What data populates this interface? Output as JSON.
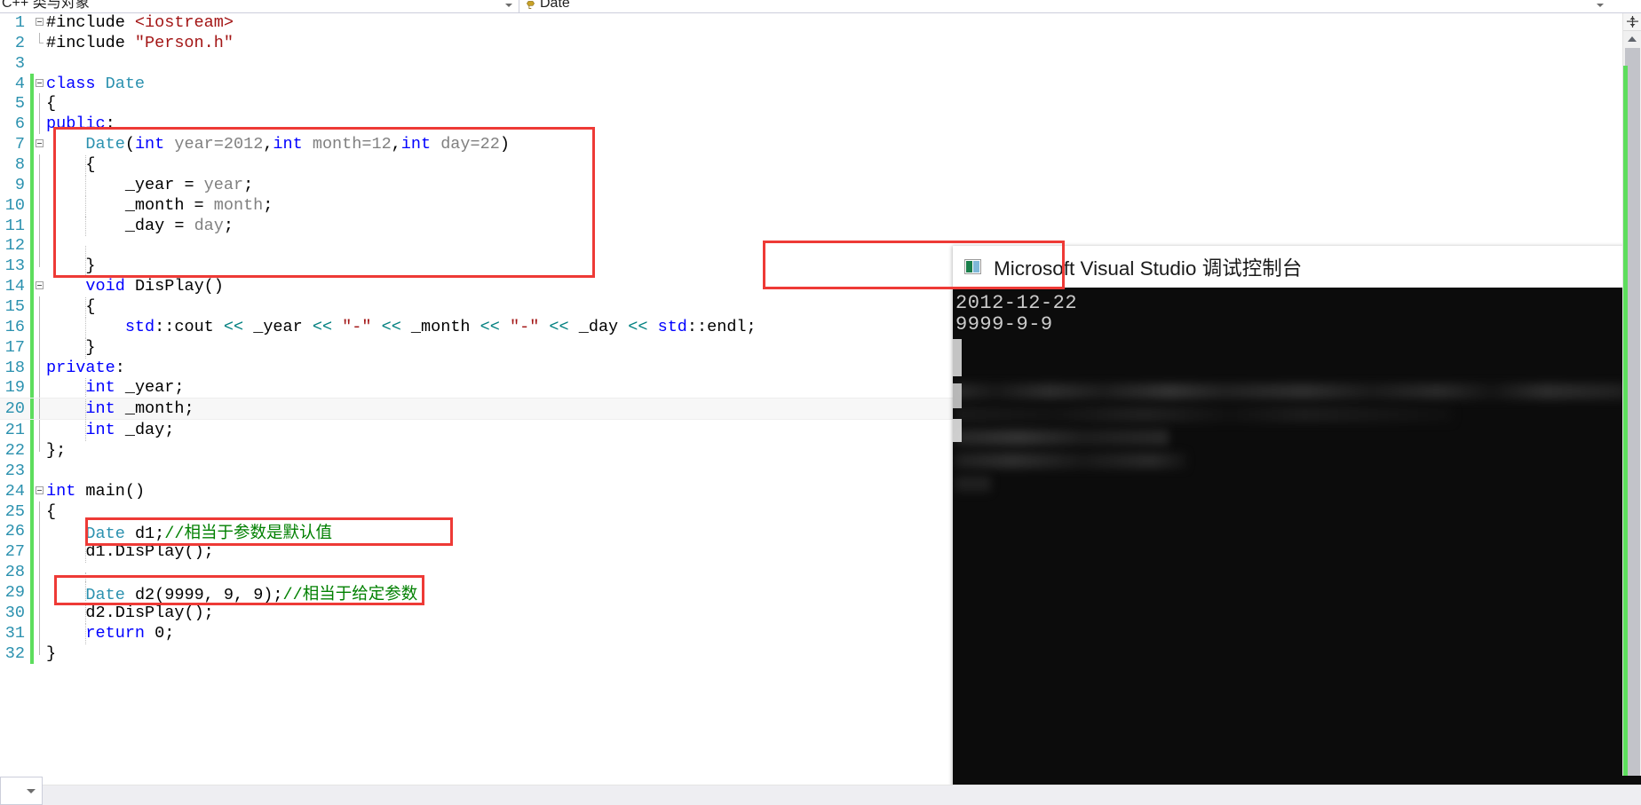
{
  "nav": {
    "left_combo": "C++ 类与对象",
    "right_combo": "Date",
    "left_caret_icon": "chevron-down-icon",
    "right_caret_icon": "chevron-down-icon",
    "class_icon": "class-icon"
  },
  "editor": {
    "lines": [
      {
        "n": "1",
        "text": "#include <iostream>"
      },
      {
        "n": "2",
        "text": "#include \"Person.h\""
      },
      {
        "n": "3",
        "text": ""
      },
      {
        "n": "4",
        "text": "class Date"
      },
      {
        "n": "5",
        "text": "{"
      },
      {
        "n": "6",
        "text": "public:"
      },
      {
        "n": "7",
        "text": "    Date(int year=2012,int month=12,int day=22)"
      },
      {
        "n": "8",
        "text": "    {"
      },
      {
        "n": "9",
        "text": "        _year = year;"
      },
      {
        "n": "10",
        "text": "        _month = month;"
      },
      {
        "n": "11",
        "text": "        _day = day;"
      },
      {
        "n": "12",
        "text": ""
      },
      {
        "n": "13",
        "text": "    }"
      },
      {
        "n": "14",
        "text": "    void DisPlay()"
      },
      {
        "n": "15",
        "text": "    {"
      },
      {
        "n": "16",
        "text": "        std::cout << _year << \"-\" << _month << \"-\" << _day << std::endl;"
      },
      {
        "n": "17",
        "text": "    }"
      },
      {
        "n": "18",
        "text": "private:"
      },
      {
        "n": "19",
        "text": "    int _year;"
      },
      {
        "n": "20",
        "text": "    int _month;"
      },
      {
        "n": "21",
        "text": "    int _day;"
      },
      {
        "n": "22",
        "text": "};"
      },
      {
        "n": "23",
        "text": ""
      },
      {
        "n": "24",
        "text": "int main()"
      },
      {
        "n": "25",
        "text": "{"
      },
      {
        "n": "26",
        "text": "    Date d1;//相当于参数是默认值"
      },
      {
        "n": "27",
        "text": "    d1.DisPlay();"
      },
      {
        "n": "28",
        "text": ""
      },
      {
        "n": "29",
        "text": "    Date d2(9999, 9, 9);//相当于给定参数"
      },
      {
        "n": "30",
        "text": "    d2.DisPlay();"
      },
      {
        "n": "31",
        "text": "    return 0;"
      },
      {
        "n": "32",
        "text": "}"
      }
    ]
  },
  "console": {
    "title": "Microsoft Visual Studio 调试控制台",
    "icon": "console-app-icon",
    "output_lines": [
      "2012-12-22",
      "9999-9-9"
    ]
  },
  "annotations": {
    "boxes": [
      {
        "name": "constructor-highlight-box",
        "color": "#ee3a36"
      },
      {
        "name": "console-output-highlight-box",
        "color": "#ee3a36"
      },
      {
        "name": "default-args-call-box",
        "color": "#ee3a36"
      },
      {
        "name": "given-args-call-box",
        "color": "#ee3a36"
      }
    ]
  },
  "scrollbar": {
    "split_icon": "split-window-icon",
    "up_arrow_icon": "chevron-up-icon",
    "change_bar_color": "#5ddd5d"
  },
  "status": {
    "zoom_caret_icon": "chevron-down-icon"
  }
}
